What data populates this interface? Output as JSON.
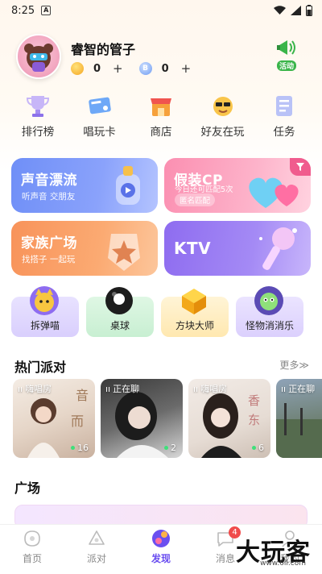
{
  "status": {
    "time": "8:25",
    "notification_letter": "A"
  },
  "profile": {
    "username": "睿智的管子",
    "gold_coins": "0",
    "blue_coins": "0",
    "blue_coin_letter": "B",
    "plus": "+",
    "activity_label": "活动"
  },
  "quick_nav": [
    {
      "label": "排行榜",
      "icon": "trophy-icon"
    },
    {
      "label": "唱玩卡",
      "icon": "card-icon"
    },
    {
      "label": "商店",
      "icon": "shop-icon"
    },
    {
      "label": "好友在玩",
      "icon": "friends-icon"
    },
    {
      "label": "任务",
      "icon": "task-icon"
    }
  ],
  "cards": {
    "voice": {
      "title": "声音漂流",
      "subtitle": "听声音 交朋友"
    },
    "cp": {
      "title": "假装CP",
      "subtitle": "今日还可匹配5次",
      "tag": "匿名匹配"
    },
    "family": {
      "title": "家族广场",
      "subtitle": "找搭子 一起玩"
    },
    "ktv": {
      "title": "KTV"
    }
  },
  "mini_games": [
    {
      "label": "拆弹喵",
      "icon": "cat-icon"
    },
    {
      "label": "桌球",
      "icon": "billiard-ball-icon"
    },
    {
      "label": "方块大师",
      "icon": "block-icon"
    },
    {
      "label": "怪物消消乐",
      "icon": "monster-icon"
    }
  ],
  "hot_party": {
    "title": "热门派对",
    "more": "更多≫",
    "rooms": [
      {
        "tag": "嗨唱房",
        "count": "16"
      },
      {
        "tag": "正在聊",
        "count": "2"
      },
      {
        "tag": "嗨唱房",
        "count": "6"
      },
      {
        "tag": "正在聊",
        "count": ""
      }
    ]
  },
  "plaza": {
    "title": "广场"
  },
  "tabbar": [
    {
      "label": "首页",
      "active": false
    },
    {
      "label": "派对",
      "active": false
    },
    {
      "label": "发现",
      "active": true
    },
    {
      "label": "消息",
      "active": false,
      "badge": "4"
    },
    {
      "label": "我的",
      "active": false
    }
  ],
  "watermark": {
    "text": "大玩客",
    "url": "www.6ll.com"
  },
  "colors": {
    "accent": "#6b4ff0",
    "badge": "#f04b4b"
  }
}
